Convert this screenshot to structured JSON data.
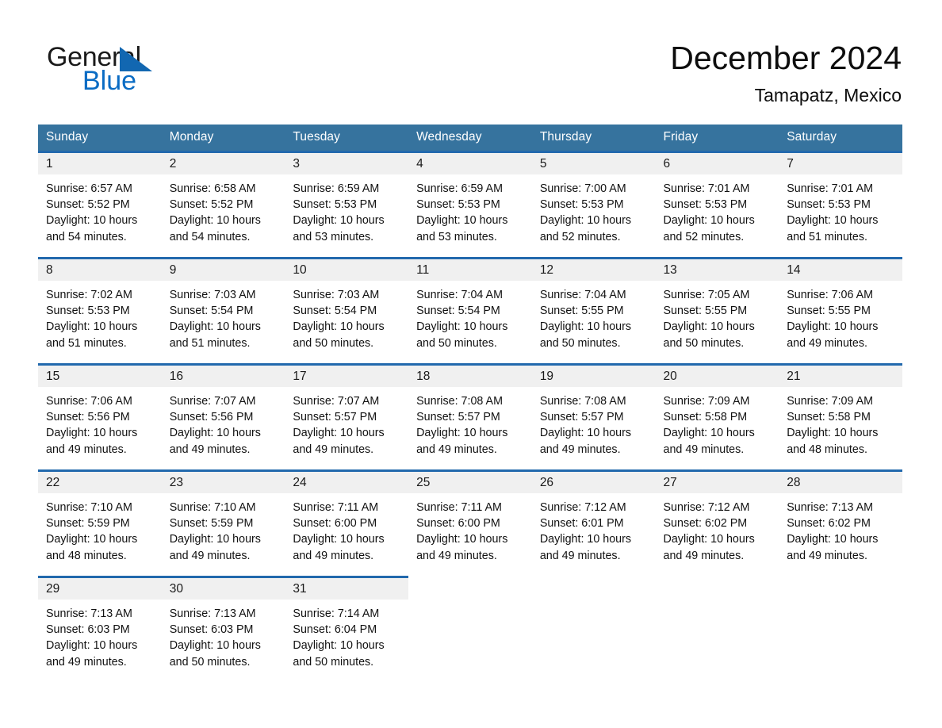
{
  "brand": {
    "name_part1": "General",
    "name_part2": "Blue",
    "accent_color": "#1267b1",
    "blue_text_color": "#0a6cc4",
    "triangle_icon": "triangle-icon"
  },
  "header": {
    "month_title": "December 2024",
    "location": "Tamapatz, Mexico"
  },
  "theme": {
    "header_row_color": "#36739e",
    "row_divider_color": "#2269ad",
    "daynum_band_color": "#f0f0f0"
  },
  "weekdays": [
    "Sunday",
    "Monday",
    "Tuesday",
    "Wednesday",
    "Thursday",
    "Friday",
    "Saturday"
  ],
  "weeks": [
    [
      {
        "day": "1",
        "sunrise": "Sunrise: 6:57 AM",
        "sunset": "Sunset: 5:52 PM",
        "daylight_line1": "Daylight: 10 hours",
        "daylight_line2": "and 54 minutes."
      },
      {
        "day": "2",
        "sunrise": "Sunrise: 6:58 AM",
        "sunset": "Sunset: 5:52 PM",
        "daylight_line1": "Daylight: 10 hours",
        "daylight_line2": "and 54 minutes."
      },
      {
        "day": "3",
        "sunrise": "Sunrise: 6:59 AM",
        "sunset": "Sunset: 5:53 PM",
        "daylight_line1": "Daylight: 10 hours",
        "daylight_line2": "and 53 minutes."
      },
      {
        "day": "4",
        "sunrise": "Sunrise: 6:59 AM",
        "sunset": "Sunset: 5:53 PM",
        "daylight_line1": "Daylight: 10 hours",
        "daylight_line2": "and 53 minutes."
      },
      {
        "day": "5",
        "sunrise": "Sunrise: 7:00 AM",
        "sunset": "Sunset: 5:53 PM",
        "daylight_line1": "Daylight: 10 hours",
        "daylight_line2": "and 52 minutes."
      },
      {
        "day": "6",
        "sunrise": "Sunrise: 7:01 AM",
        "sunset": "Sunset: 5:53 PM",
        "daylight_line1": "Daylight: 10 hours",
        "daylight_line2": "and 52 minutes."
      },
      {
        "day": "7",
        "sunrise": "Sunrise: 7:01 AM",
        "sunset": "Sunset: 5:53 PM",
        "daylight_line1": "Daylight: 10 hours",
        "daylight_line2": "and 51 minutes."
      }
    ],
    [
      {
        "day": "8",
        "sunrise": "Sunrise: 7:02 AM",
        "sunset": "Sunset: 5:53 PM",
        "daylight_line1": "Daylight: 10 hours",
        "daylight_line2": "and 51 minutes."
      },
      {
        "day": "9",
        "sunrise": "Sunrise: 7:03 AM",
        "sunset": "Sunset: 5:54 PM",
        "daylight_line1": "Daylight: 10 hours",
        "daylight_line2": "and 51 minutes."
      },
      {
        "day": "10",
        "sunrise": "Sunrise: 7:03 AM",
        "sunset": "Sunset: 5:54 PM",
        "daylight_line1": "Daylight: 10 hours",
        "daylight_line2": "and 50 minutes."
      },
      {
        "day": "11",
        "sunrise": "Sunrise: 7:04 AM",
        "sunset": "Sunset: 5:54 PM",
        "daylight_line1": "Daylight: 10 hours",
        "daylight_line2": "and 50 minutes."
      },
      {
        "day": "12",
        "sunrise": "Sunrise: 7:04 AM",
        "sunset": "Sunset: 5:55 PM",
        "daylight_line1": "Daylight: 10 hours",
        "daylight_line2": "and 50 minutes."
      },
      {
        "day": "13",
        "sunrise": "Sunrise: 7:05 AM",
        "sunset": "Sunset: 5:55 PM",
        "daylight_line1": "Daylight: 10 hours",
        "daylight_line2": "and 50 minutes."
      },
      {
        "day": "14",
        "sunrise": "Sunrise: 7:06 AM",
        "sunset": "Sunset: 5:55 PM",
        "daylight_line1": "Daylight: 10 hours",
        "daylight_line2": "and 49 minutes."
      }
    ],
    [
      {
        "day": "15",
        "sunrise": "Sunrise: 7:06 AM",
        "sunset": "Sunset: 5:56 PM",
        "daylight_line1": "Daylight: 10 hours",
        "daylight_line2": "and 49 minutes."
      },
      {
        "day": "16",
        "sunrise": "Sunrise: 7:07 AM",
        "sunset": "Sunset: 5:56 PM",
        "daylight_line1": "Daylight: 10 hours",
        "daylight_line2": "and 49 minutes."
      },
      {
        "day": "17",
        "sunrise": "Sunrise: 7:07 AM",
        "sunset": "Sunset: 5:57 PM",
        "daylight_line1": "Daylight: 10 hours",
        "daylight_line2": "and 49 minutes."
      },
      {
        "day": "18",
        "sunrise": "Sunrise: 7:08 AM",
        "sunset": "Sunset: 5:57 PM",
        "daylight_line1": "Daylight: 10 hours",
        "daylight_line2": "and 49 minutes."
      },
      {
        "day": "19",
        "sunrise": "Sunrise: 7:08 AM",
        "sunset": "Sunset: 5:57 PM",
        "daylight_line1": "Daylight: 10 hours",
        "daylight_line2": "and 49 minutes."
      },
      {
        "day": "20",
        "sunrise": "Sunrise: 7:09 AM",
        "sunset": "Sunset: 5:58 PM",
        "daylight_line1": "Daylight: 10 hours",
        "daylight_line2": "and 49 minutes."
      },
      {
        "day": "21",
        "sunrise": "Sunrise: 7:09 AM",
        "sunset": "Sunset: 5:58 PM",
        "daylight_line1": "Daylight: 10 hours",
        "daylight_line2": "and 48 minutes."
      }
    ],
    [
      {
        "day": "22",
        "sunrise": "Sunrise: 7:10 AM",
        "sunset": "Sunset: 5:59 PM",
        "daylight_line1": "Daylight: 10 hours",
        "daylight_line2": "and 48 minutes."
      },
      {
        "day": "23",
        "sunrise": "Sunrise: 7:10 AM",
        "sunset": "Sunset: 5:59 PM",
        "daylight_line1": "Daylight: 10 hours",
        "daylight_line2": "and 49 minutes."
      },
      {
        "day": "24",
        "sunrise": "Sunrise: 7:11 AM",
        "sunset": "Sunset: 6:00 PM",
        "daylight_line1": "Daylight: 10 hours",
        "daylight_line2": "and 49 minutes."
      },
      {
        "day": "25",
        "sunrise": "Sunrise: 7:11 AM",
        "sunset": "Sunset: 6:00 PM",
        "daylight_line1": "Daylight: 10 hours",
        "daylight_line2": "and 49 minutes."
      },
      {
        "day": "26",
        "sunrise": "Sunrise: 7:12 AM",
        "sunset": "Sunset: 6:01 PM",
        "daylight_line1": "Daylight: 10 hours",
        "daylight_line2": "and 49 minutes."
      },
      {
        "day": "27",
        "sunrise": "Sunrise: 7:12 AM",
        "sunset": "Sunset: 6:02 PM",
        "daylight_line1": "Daylight: 10 hours",
        "daylight_line2": "and 49 minutes."
      },
      {
        "day": "28",
        "sunrise": "Sunrise: 7:13 AM",
        "sunset": "Sunset: 6:02 PM",
        "daylight_line1": "Daylight: 10 hours",
        "daylight_line2": "and 49 minutes."
      }
    ],
    [
      {
        "day": "29",
        "sunrise": "Sunrise: 7:13 AM",
        "sunset": "Sunset: 6:03 PM",
        "daylight_line1": "Daylight: 10 hours",
        "daylight_line2": "and 49 minutes."
      },
      {
        "day": "30",
        "sunrise": "Sunrise: 7:13 AM",
        "sunset": "Sunset: 6:03 PM",
        "daylight_line1": "Daylight: 10 hours",
        "daylight_line2": "and 50 minutes."
      },
      {
        "day": "31",
        "sunrise": "Sunrise: 7:14 AM",
        "sunset": "Sunset: 6:04 PM",
        "daylight_line1": "Daylight: 10 hours",
        "daylight_line2": "and 50 minutes."
      },
      {
        "day": "",
        "sunrise": "",
        "sunset": "",
        "daylight_line1": "",
        "daylight_line2": ""
      },
      {
        "day": "",
        "sunrise": "",
        "sunset": "",
        "daylight_line1": "",
        "daylight_line2": ""
      },
      {
        "day": "",
        "sunrise": "",
        "sunset": "",
        "daylight_line1": "",
        "daylight_line2": ""
      },
      {
        "day": "",
        "sunrise": "",
        "sunset": "",
        "daylight_line1": "",
        "daylight_line2": ""
      }
    ]
  ]
}
